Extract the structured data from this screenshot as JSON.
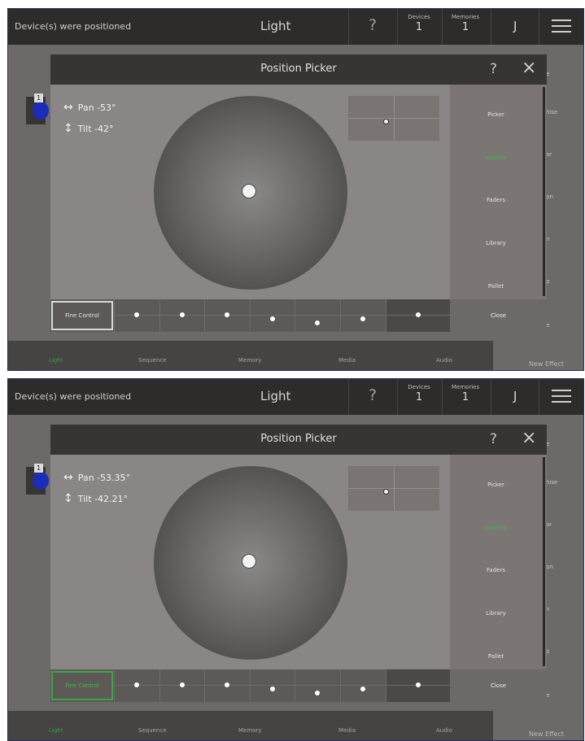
{
  "topbar": {
    "status": "Device(s) were positioned",
    "title": "Light",
    "help": "?",
    "devices_label": "Devices",
    "devices_value": "1",
    "memories_label": "Memories",
    "memories_value": "1",
    "user": "J"
  },
  "background": {
    "fixture_badge": "1",
    "side_fragments": [
      "e",
      "hise",
      "ar",
      "pn",
      "n",
      "p",
      "e"
    ],
    "new_effect": "New Effect"
  },
  "bottom_nav": [
    "Light",
    "Sequence",
    "Memory",
    "Media",
    "Audio"
  ],
  "dialog": {
    "title": "Position Picker",
    "help": "?",
    "close_icon": "×",
    "sidebar_items": [
      "Picker",
      "Joystick",
      "Faders",
      "Library",
      "Pallet"
    ],
    "fine_control": "Fine Control",
    "close": "Close"
  },
  "screens": [
    {
      "pan": "Pan  -53°",
      "tilt": "Tilt  -42°",
      "fine_control_active": false
    },
    {
      "pan": "Pan  -53.35°",
      "tilt": "Tilt  -42.21°",
      "fine_control_active": true
    }
  ],
  "colors": {
    "accent_active": "#3fbb4a",
    "fixture_blue": "#1c2cb8"
  }
}
